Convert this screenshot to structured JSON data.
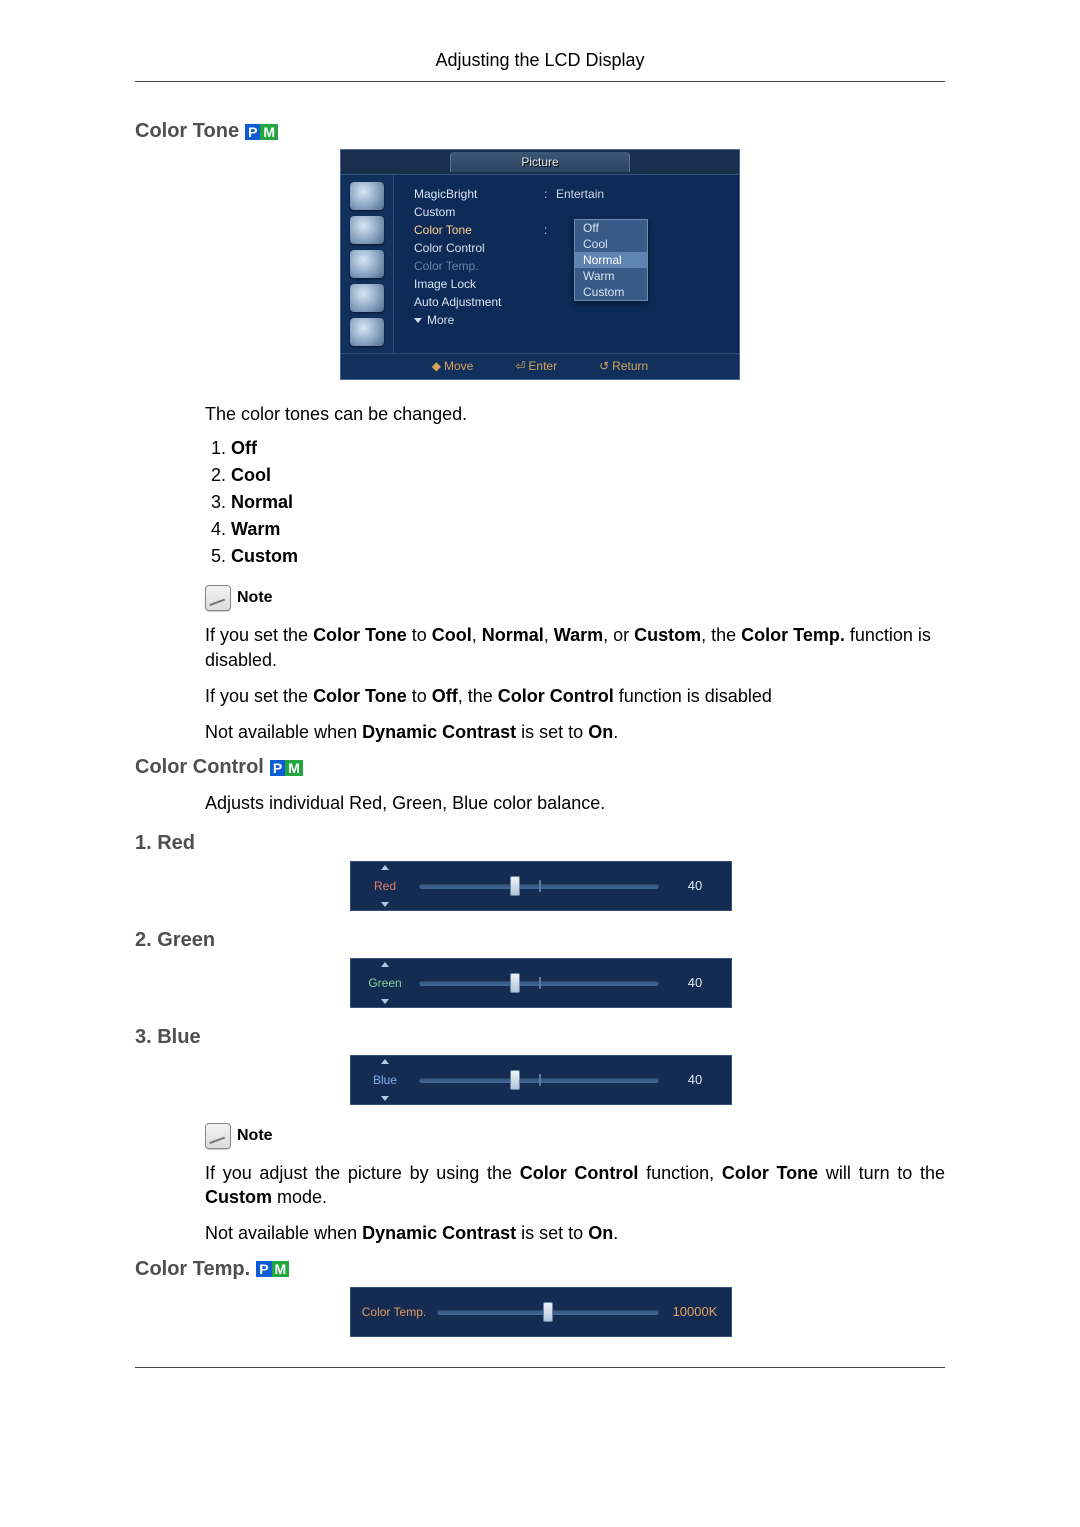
{
  "page": {
    "header": "Adjusting the LCD Display"
  },
  "sections": {
    "color_tone": {
      "heading": "Color Tone",
      "intro": "The color tones can be changed.",
      "options": [
        "Off",
        "Cool",
        "Normal",
        "Warm",
        "Custom"
      ],
      "note_label": "Note",
      "note1_pre": "If you set the ",
      "note1_b1": "Color Tone",
      "note1_mid1": " to ",
      "note1_b2": "Cool",
      "note1_sep": ", ",
      "note1_b3": "Normal",
      "note1_b4": "Warm",
      "note1_mid2": ", or ",
      "note1_b5": "Custom",
      "note1_mid3": ", the ",
      "note1_b6": "Color Temp.",
      "note1_end": " function is disabled.",
      "note2_pre": "If you set the ",
      "note2_b1": "Color Tone",
      "note2_mid1": " to ",
      "note2_b2": "Off",
      "note2_mid2": ", the ",
      "note2_b3": "Color Control",
      "note2_end": " function is disabled",
      "note3_pre": "Not available when ",
      "note3_b1": "Dynamic Contrast",
      "note3_mid": " is set to ",
      "note3_b2": "On",
      "note3_end": "."
    },
    "color_control": {
      "heading": "Color Control",
      "intro": "Adjusts individual Red, Green, Blue color balance.",
      "red_heading": "1. Red",
      "green_heading": "2. Green",
      "blue_heading": "3. Blue",
      "note_label": "Note",
      "note1_pre": "If you adjust the picture by using the ",
      "note1_b1": "Color Control",
      "note1_mid1": " function, ",
      "note1_b2": "Color Tone",
      "note1_mid2": " will turn to the ",
      "note1_b3": "Custom",
      "note1_end": " mode.",
      "note2_pre": "Not available when ",
      "note2_b1": "Dynamic Contrast",
      "note2_mid": " is set to ",
      "note2_b2": "On",
      "note2_end": "."
    },
    "color_temp": {
      "heading": "Color Temp."
    }
  },
  "osd": {
    "title_tab": "Picture",
    "labels": {
      "magicbright": "MagicBright",
      "custom": "Custom",
      "color_tone": "Color Tone",
      "color_control": "Color Control",
      "color_temp": "Color Temp.",
      "image_lock": "Image Lock",
      "auto_adjustment": "Auto Adjustment",
      "more": "More"
    },
    "values": {
      "magicbright": "Entertain"
    },
    "color_tone_options": [
      "Off",
      "Cool",
      "Normal",
      "Warm",
      "Custom"
    ],
    "footer": {
      "move": "Move",
      "enter": "Enter",
      "return": "Return"
    }
  },
  "sliders": {
    "red": {
      "label": "Red",
      "value": "40",
      "percent": 40
    },
    "green": {
      "label": "Green",
      "value": "40",
      "percent": 40
    },
    "blue": {
      "label": "Blue",
      "value": "40",
      "percent": 40
    },
    "color_temp": {
      "label": "Color Temp.",
      "value": "10000K",
      "percent": 50
    }
  }
}
